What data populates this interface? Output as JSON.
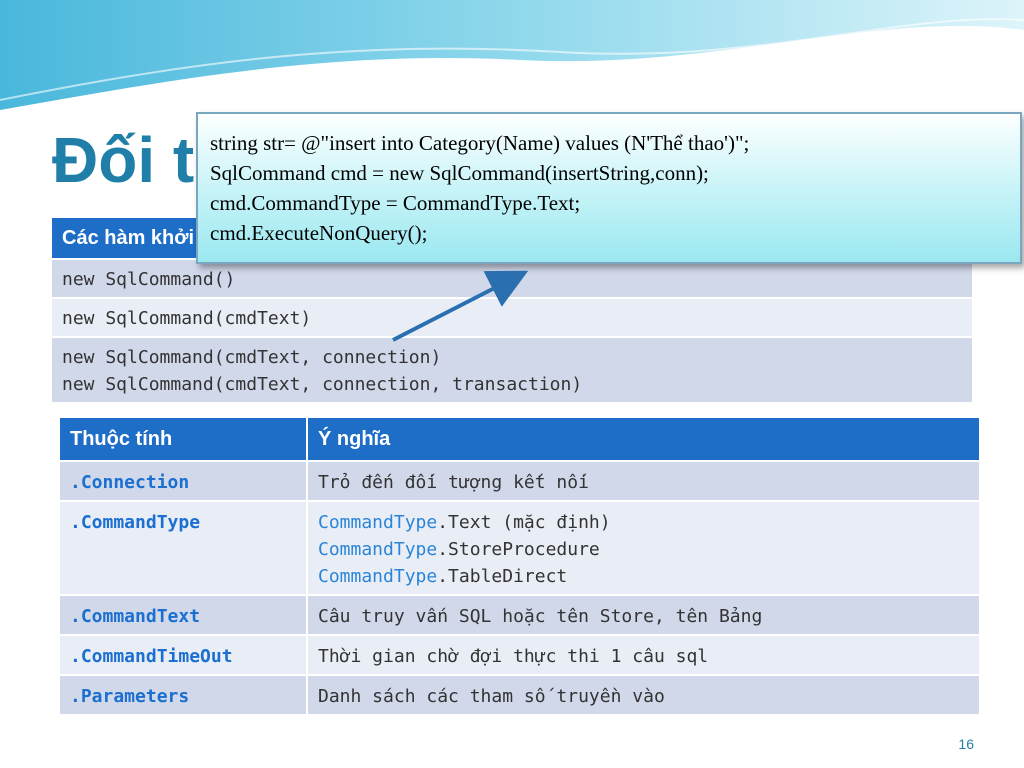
{
  "slide": {
    "title": "Đối tượng",
    "page_number": "16"
  },
  "callout": {
    "lines": [
      "string str= @\"insert into Category(Name) values (N'Thể thao')\";",
      "SqlCommand cmd = new SqlCommand(insertString,conn);",
      "cmd.CommandType = CommandType.Text;",
      "cmd.ExecuteNonQuery();"
    ]
  },
  "constructors": {
    "header": "Các hàm khởi tạo",
    "rows": [
      [
        "new SqlCommand()"
      ],
      [
        "new SqlCommand(cmdText)"
      ],
      [
        "new SqlCommand(cmdText, connection)",
        "new SqlCommand(cmdText, connection, transaction)"
      ]
    ]
  },
  "properties": {
    "headers": [
      "Thuộc tính",
      "Ý nghĩa"
    ],
    "rows": [
      {
        "name": ".Connection",
        "desc": "Trỏ đến đối tượng kết nối"
      },
      {
        "name": ".CommandType",
        "values": [
          {
            "kw": "CommandType",
            "rest": ".Text (mặc định)"
          },
          {
            "kw": "CommandType",
            "rest": ".StoreProcedure"
          },
          {
            "kw": "CommandType",
            "rest": ".TableDirect"
          }
        ]
      },
      {
        "name": ".CommandText",
        "desc": "Câu truy vấn SQL hoặc tên Store, tên Bảng"
      },
      {
        "name": ".CommandTimeOut",
        "desc": "Thời gian chờ đợi thực thi 1 câu sql"
      },
      {
        "name": ".Parameters",
        "desc": "Danh sách các tham số truyền vào"
      }
    ]
  },
  "colors": {
    "header_bg": "#1e6ec8",
    "title": "#1f7fa8",
    "property_name": "#1a6fd0"
  }
}
